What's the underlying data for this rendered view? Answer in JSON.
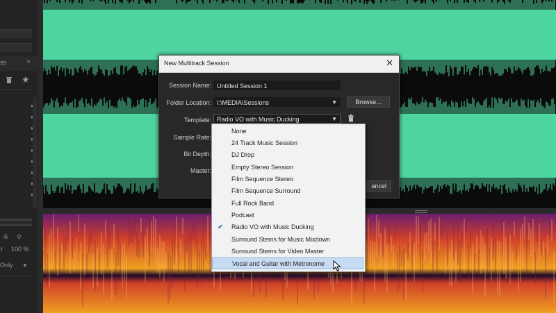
{
  "left_panel": {
    "frag_text": "ss",
    "meter_labels": [
      "-6",
      "0"
    ],
    "pct_left": "t",
    "pct_right": "100 %",
    "only_label": "Only"
  },
  "dialog": {
    "title": "New Multitrack Session",
    "fields": {
      "session_name": {
        "label": "Session Name:",
        "value": "Untitled Session 1"
      },
      "folder_location": {
        "label": "Folder Location:",
        "value": "I:\\MEDIA\\Sessions"
      },
      "template": {
        "label": "Template:",
        "value": "Radio VO with Music Ducking"
      },
      "sample_rate": {
        "label": "Sample Rate:"
      },
      "bit_depth": {
        "label": "Bit Depth:"
      },
      "master": {
        "label": "Master:"
      }
    },
    "browse_label": "Browse...",
    "cancel_label": "ancel"
  },
  "template_menu": {
    "options": [
      "None",
      "24 Track Music Session",
      "DJ Drop",
      "Empty Stereo Session",
      "Film Sequence Stereo",
      "Film Sequence Surround",
      "Full Rock Band",
      "Podcast",
      "Radio VO with Music Ducking",
      "Surround Stems for Music Mixdown",
      "Surround Stems for Video Master",
      "Vocal and Guitar with Metronome"
    ],
    "selected_index": 8,
    "hovered_index": 11
  },
  "colors": {
    "waveform": "#4fd6a0",
    "spectral_hot": "#f0a020",
    "spectral_mid": "#d0402a",
    "spectral_low": "#6a1e6e",
    "menu_highlight": "#c7dcf3"
  },
  "icons": [
    "double-chevron-right-icon",
    "trash-icon",
    "star-icon",
    "close-icon",
    "chevron-down-icon",
    "checkmark-icon",
    "mouse-pointer-icon"
  ]
}
